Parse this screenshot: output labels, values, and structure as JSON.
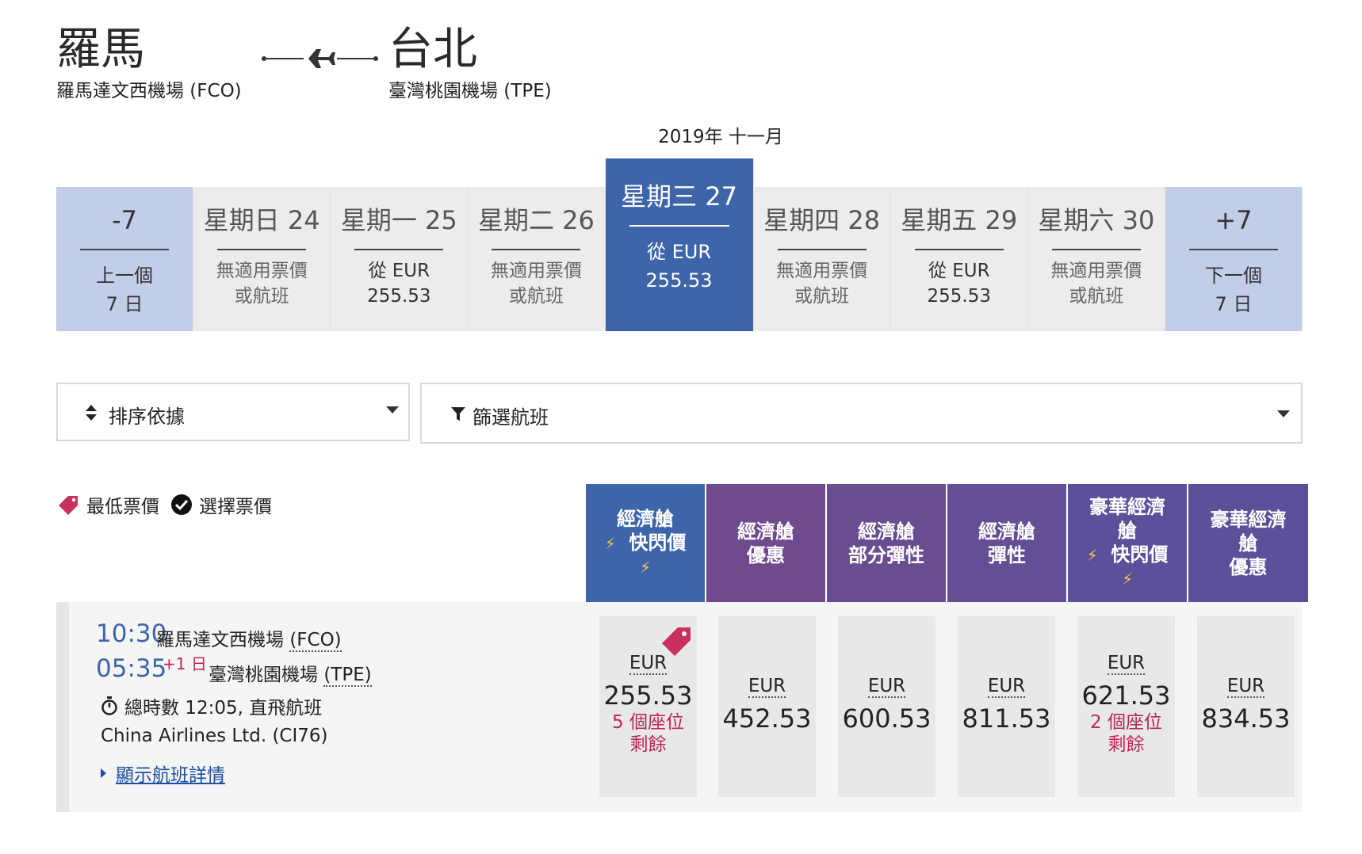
{
  "route": {
    "origin_city": "羅馬",
    "origin_airport": "羅馬達文西機場 (FCO)",
    "dest_city": "台北",
    "dest_airport": "臺灣桃園機場 (TPE)"
  },
  "month_label": "2019年 十一月",
  "date_strip": {
    "prev": {
      "label": "-7",
      "line1": "上一個",
      "line2": "7 日"
    },
    "next": {
      "label": "+7",
      "line1": "下一個",
      "line2": "7 日"
    },
    "days": [
      {
        "label": "星期日 24",
        "line1": "無適用票價",
        "line2": "或航班"
      },
      {
        "label": "星期一 25",
        "line1": "從 EUR",
        "line2": "255.53"
      },
      {
        "label": "星期二 26",
        "line1": "無適用票價",
        "line2": "或航班"
      },
      {
        "label": "星期三 27",
        "line1": "從 EUR",
        "line2": "255.53"
      },
      {
        "label": "星期四 28",
        "line1": "無適用票價",
        "line2": "或航班"
      },
      {
        "label": "星期五 29",
        "line1": "從 EUR",
        "line2": "255.53"
      },
      {
        "label": "星期六 30",
        "line1": "無適用票價",
        "line2": "或航班"
      }
    ]
  },
  "sort": {
    "label": "排序依據"
  },
  "filter": {
    "label": "篩選航班"
  },
  "legend": {
    "lowest": "最低票價",
    "selected": "選擇票價"
  },
  "fare_headers": [
    {
      "line1": "經濟艙",
      "line2": "快閃價",
      "color": "#3e65aa"
    },
    {
      "line1": "經濟艙",
      "line2": "優惠",
      "color": "#6f4a8e"
    },
    {
      "line1": "經濟艙",
      "line2": "部分彈性",
      "color": "#6a4d90"
    },
    {
      "line1": "經濟艙",
      "line2": "彈性",
      "color": "#644f95"
    },
    {
      "line1": "豪華經濟",
      "line2": "艙",
      "line3": "快閃價",
      "color": "#5a519a"
    },
    {
      "line1": "豪華經濟",
      "line2": "艙",
      "line3": "優惠",
      "color": "#5a519a"
    }
  ],
  "flight": {
    "depart_time": "10:30",
    "depart_airport": "羅馬達文西機場",
    "depart_code": "(FCO)",
    "arrive_time": "05:35",
    "plus_day": "+1 日",
    "arrive_airport": "臺灣桃園機場",
    "arrive_code": "(TPE)",
    "duration": "總時數 12:05, 直飛航班",
    "carrier": "China Airlines Ltd. (CI76)",
    "details_link": "顯示航班詳情"
  },
  "prices": [
    {
      "currency": "EUR",
      "amount": "255.53",
      "seats1": "5 個座位",
      "seats2": "剩餘"
    },
    {
      "currency": "EUR",
      "amount": "452.53"
    },
    {
      "currency": "EUR",
      "amount": "600.53"
    },
    {
      "currency": "EUR",
      "amount": "811.53"
    },
    {
      "currency": "EUR",
      "amount": "621.53",
      "seats1": "2 個座位",
      "seats2": "剩餘"
    },
    {
      "currency": "EUR",
      "amount": "834.53"
    }
  ],
  "colors": {
    "accent_blue": "#3e65aa",
    "nav_light_blue": "#c2cde8",
    "seats_red": "#c0245a",
    "tag_red": "#c8305e"
  },
  "icons": {
    "route": "airplane-icon",
    "sort": "sort-arrows-icon",
    "filter": "funnel-icon",
    "lowest": "price-tag-icon",
    "selected": "check-circle-icon",
    "duration": "stopwatch-icon",
    "flash": "lightning-icon"
  }
}
